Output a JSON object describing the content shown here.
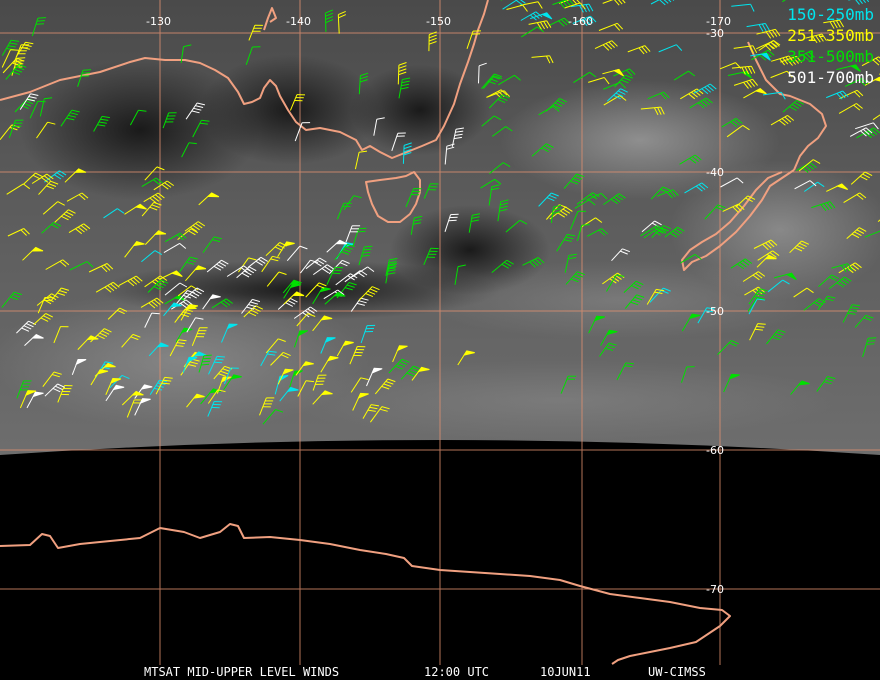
{
  "legend": [
    {
      "text": "150-250mb",
      "color": "#00e5ee"
    },
    {
      "text": "251-350mb",
      "color": "#ffff00"
    },
    {
      "text": "351-500mb",
      "color": "#00e000"
    },
    {
      "text": "501-700mb",
      "color": "#ffffff"
    }
  ],
  "footer": {
    "product": "MTSAT MID-UPPER LEVEL WINDS",
    "time": "12:00 UTC",
    "date": "10JUN11",
    "source": "UW-CIMSS"
  },
  "longitude_labels": [
    "-130",
    "-140",
    "-150",
    "-160",
    "-170"
  ],
  "latitude_labels": [
    "-30",
    "-40",
    "-50",
    "-60",
    "-70"
  ],
  "colors": {
    "coastline": "#f0a080",
    "grid": "#e09070",
    "background": "#000000"
  }
}
